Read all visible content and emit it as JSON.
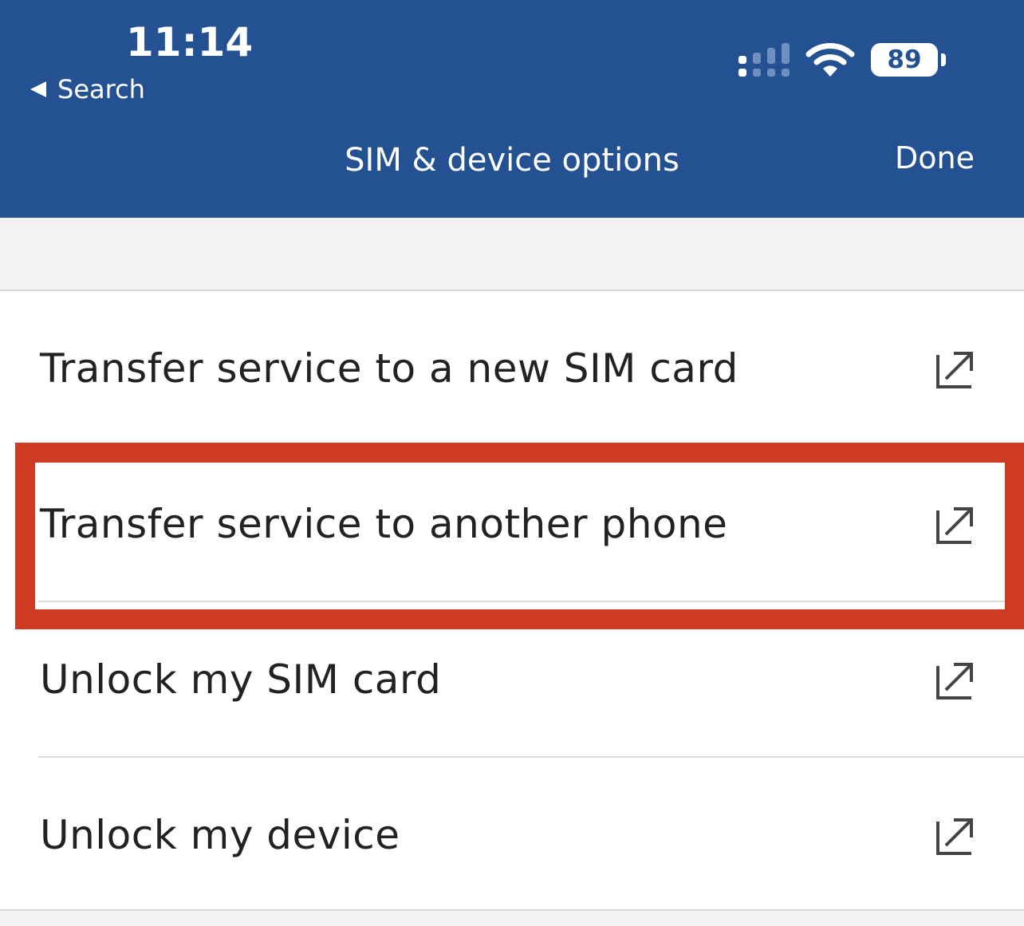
{
  "status_bar": {
    "time": "11:14",
    "back_label": "Search",
    "battery": "89",
    "icons": [
      "signal-icon",
      "wifi-icon",
      "battery-icon"
    ]
  },
  "nav": {
    "title": "SIM & device options",
    "done_label": "Done"
  },
  "items": [
    {
      "label": "Transfer service to a new SIM card",
      "icon": "external-link-icon"
    },
    {
      "label": "Transfer service to another phone",
      "icon": "external-link-icon",
      "highlighted": true
    },
    {
      "label": "Unlock my SIM card",
      "icon": "external-link-icon"
    },
    {
      "label": "Unlock my device",
      "icon": "external-link-icon"
    }
  ],
  "colors": {
    "header_bg": "#235192",
    "highlight": "#cf3b22",
    "text": "#222222"
  }
}
